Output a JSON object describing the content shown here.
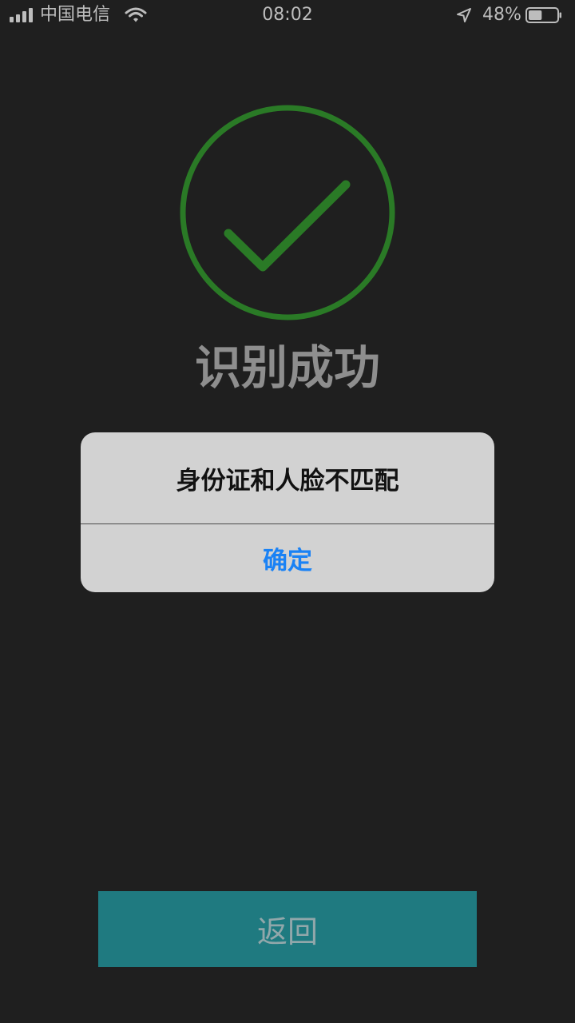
{
  "status_bar": {
    "carrier": "中国电信",
    "time": "08:02",
    "battery_percent": "48%",
    "battery_level": 0.48,
    "icons": [
      "signal-icon",
      "wifi-icon",
      "location-arrow-icon",
      "battery-icon"
    ]
  },
  "result": {
    "title": "识别成功",
    "icon": "check-circle-icon",
    "icon_color": "#2a7a26"
  },
  "alert": {
    "message": "身份证和人脸不匹配",
    "confirm_label": "确定",
    "confirm_color": "#1a82f5"
  },
  "footer": {
    "back_label": "返回",
    "button_color": "#1f7a80"
  }
}
